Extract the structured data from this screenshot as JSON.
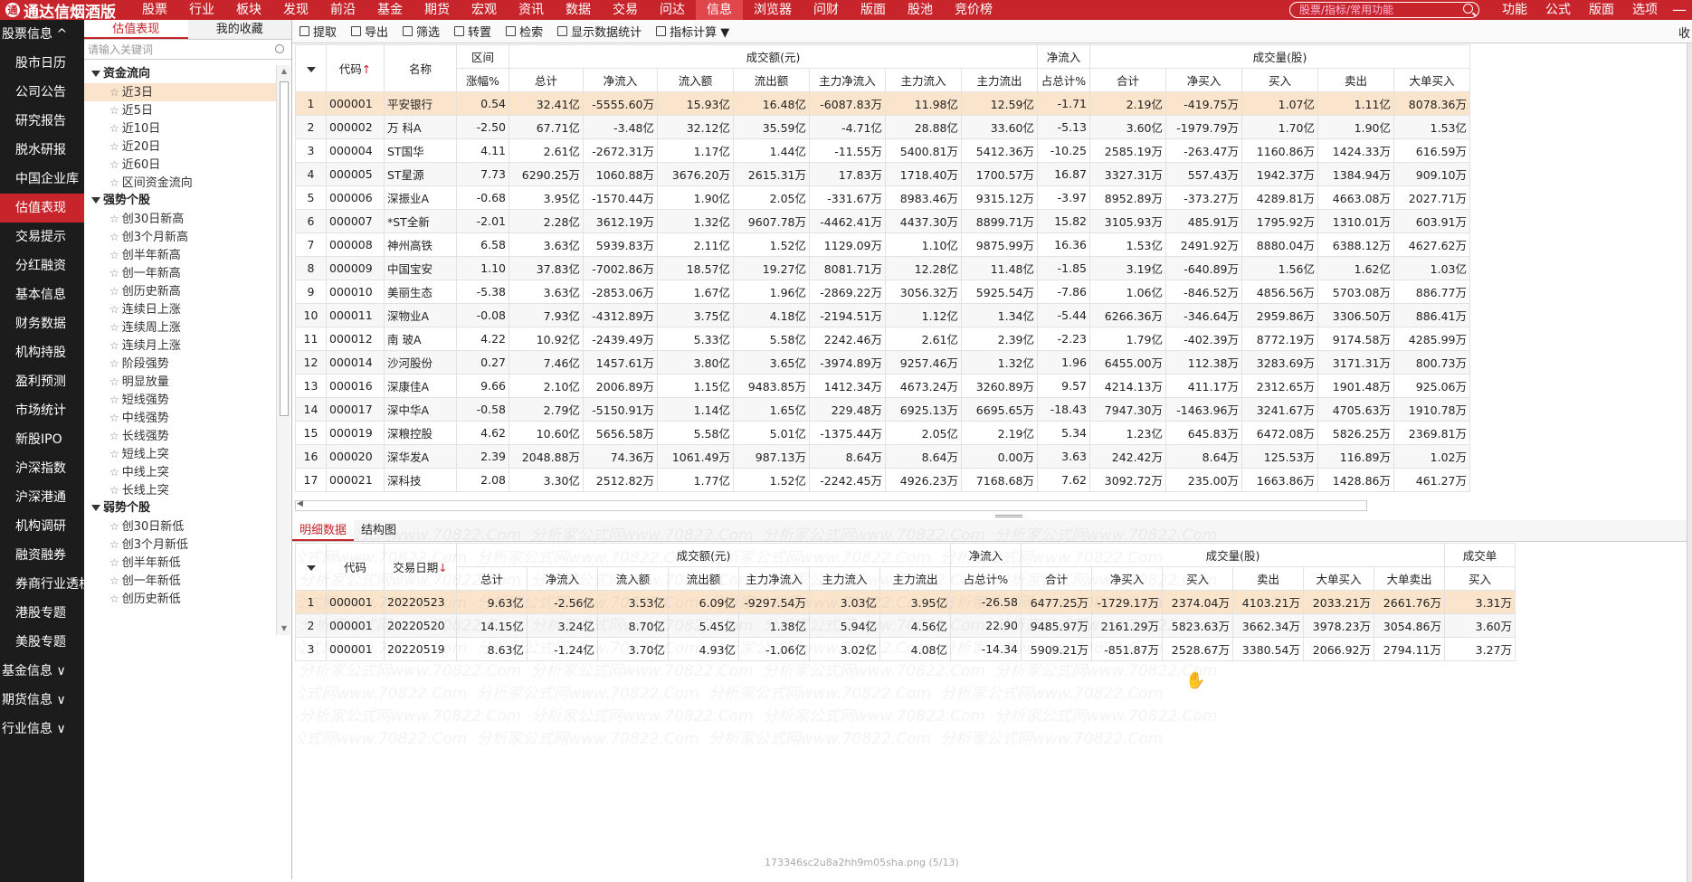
{
  "app": {
    "title": "通达信烟酒版",
    "logo_mark": "通"
  },
  "menu": [
    "股票",
    "行业",
    "板块",
    "发现",
    "前沿",
    "基金",
    "期货",
    "宏观",
    "资讯",
    "数据",
    "交易",
    "问达",
    "信息",
    "浏览器",
    "问财",
    "版面",
    "股池",
    "竞价榜"
  ],
  "search": {
    "placeholder": "股票/指标/常用功能"
  },
  "right_menu": [
    "功能",
    "公式",
    "版面",
    "选项"
  ],
  "window": {
    "minimize": "—"
  },
  "leftnav": [
    "股票信息 ^",
    "股市日历",
    "公司公告",
    "研究报告",
    "脱水研报",
    "中国企业库",
    "估值表现",
    "交易提示",
    "分红融资",
    "基本信息",
    "财务数据",
    "机构持股",
    "盈利预测",
    "市场统计",
    "新股IPO",
    "沪深指数",
    "沪深港通",
    "机构调研",
    "融资融券",
    "券商行业透析",
    "港股专题",
    "美股专题",
    "基金信息 ∨",
    "期货信息 ∨",
    "行业信息 ∨"
  ],
  "tree": {
    "tabs": [
      "估值表现",
      "我的收藏"
    ],
    "search_placeholder": "请输入关键词",
    "groups": [
      {
        "name": "资金流向",
        "items": [
          "近3日",
          "近5日",
          "近10日",
          "近20日",
          "近60日",
          "区间资金流向"
        ]
      },
      {
        "name": "强势个股",
        "items": [
          "创30日新高",
          "创3个月新高",
          "创半年新高",
          "创一年新高",
          "创历史新高",
          "连续日上涨",
          "连续周上涨",
          "连续月上涨",
          "阶段强势",
          "明显放量",
          "短线强势",
          "中线强势",
          "长线强势",
          "短线上突",
          "中线上突",
          "长线上突"
        ]
      },
      {
        "name": "弱势个股",
        "items": [
          "创30日新低",
          "创3个月新低",
          "创半年新低",
          "创一年新低",
          "创历史新低"
        ]
      }
    ]
  },
  "toolbar": {
    "buttons": [
      "提取",
      "导出",
      "筛选",
      "转置",
      "检索",
      "显示数据统计",
      "指标计算 ▼"
    ],
    "right": "收"
  },
  "top_table": {
    "group_headers": {
      "interval": "区间",
      "amount": "成交额(元)",
      "netflow": "净流入",
      "volume": "成交量(股)"
    },
    "columns": [
      "代码",
      "名称",
      "涨幅%",
      "总计",
      "净流入",
      "流入额",
      "流出额",
      "主力净流入",
      "主力流入",
      "主力流出",
      "占总计%",
      "合计",
      "净买入",
      "买入",
      "卖出",
      "大单买入"
    ],
    "code_sort": "↑",
    "rows": [
      [
        "1",
        "000001",
        "平安银行",
        "0.54",
        "32.41亿",
        "-5555.60万",
        "15.93亿",
        "16.48亿",
        "-6087.83万",
        "11.98亿",
        "12.59亿",
        "-1.71",
        "2.19亿",
        "-419.75万",
        "1.07亿",
        "1.11亿",
        "8078.36万"
      ],
      [
        "2",
        "000002",
        "万 科A",
        "-2.50",
        "67.71亿",
        "-3.48亿",
        "32.12亿",
        "35.59亿",
        "-4.71亿",
        "28.88亿",
        "33.60亿",
        "-5.13",
        "3.60亿",
        "-1979.79万",
        "1.70亿",
        "1.90亿",
        "1.53亿"
      ],
      [
        "3",
        "000004",
        "ST国华",
        "4.11",
        "2.61亿",
        "-2672.31万",
        "1.17亿",
        "1.44亿",
        "-11.55万",
        "5400.81万",
        "5412.36万",
        "-10.25",
        "2585.19万",
        "-263.47万",
        "1160.86万",
        "1424.33万",
        "616.59万"
      ],
      [
        "4",
        "000005",
        "ST星源",
        "7.73",
        "6290.25万",
        "1060.88万",
        "3676.20万",
        "2615.31万",
        "17.83万",
        "1718.40万",
        "1700.57万",
        "16.87",
        "3327.31万",
        "557.43万",
        "1942.37万",
        "1384.94万",
        "909.10万"
      ],
      [
        "5",
        "000006",
        "深振业A",
        "-0.68",
        "3.95亿",
        "-1570.44万",
        "1.90亿",
        "2.05亿",
        "-331.67万",
        "8983.46万",
        "9315.12万",
        "-3.97",
        "8952.89万",
        "-373.27万",
        "4289.81万",
        "4663.08万",
        "2027.71万"
      ],
      [
        "6",
        "000007",
        "*ST全新",
        "-2.01",
        "2.28亿",
        "3612.19万",
        "1.32亿",
        "9607.78万",
        "-4462.41万",
        "4437.30万",
        "8899.71万",
        "15.82",
        "3105.93万",
        "485.91万",
        "1795.92万",
        "1310.01万",
        "603.91万"
      ],
      [
        "7",
        "000008",
        "神州高铁",
        "6.58",
        "3.63亿",
        "5939.83万",
        "2.11亿",
        "1.52亿",
        "1129.09万",
        "1.10亿",
        "9875.99万",
        "16.36",
        "1.53亿",
        "2491.92万",
        "8880.04万",
        "6388.12万",
        "4627.62万"
      ],
      [
        "8",
        "000009",
        "中国宝安",
        "1.10",
        "37.83亿",
        "-7002.86万",
        "18.57亿",
        "19.27亿",
        "8081.71万",
        "12.28亿",
        "11.48亿",
        "-1.85",
        "3.19亿",
        "-640.89万",
        "1.56亿",
        "1.62亿",
        "1.03亿"
      ],
      [
        "9",
        "000010",
        "美丽生态",
        "-5.38",
        "3.63亿",
        "-2853.06万",
        "1.67亿",
        "1.96亿",
        "-2869.22万",
        "3056.32万",
        "5925.54万",
        "-7.86",
        "1.06亿",
        "-846.52万",
        "4856.56万",
        "5703.08万",
        "886.77万"
      ],
      [
        "10",
        "000011",
        "深物业A",
        "-0.08",
        "7.93亿",
        "-4312.89万",
        "3.75亿",
        "4.18亿",
        "-2194.51万",
        "1.12亿",
        "1.34亿",
        "-5.44",
        "6266.36万",
        "-346.64万",
        "2959.86万",
        "3306.50万",
        "886.41万"
      ],
      [
        "11",
        "000012",
        "南 玻A",
        "4.22",
        "10.92亿",
        "-2439.49万",
        "5.33亿",
        "5.58亿",
        "2242.46万",
        "2.61亿",
        "2.39亿",
        "-2.23",
        "1.79亿",
        "-402.39万",
        "8772.19万",
        "9174.58万",
        "4285.99万"
      ],
      [
        "12",
        "000014",
        "沙河股份",
        "0.27",
        "7.46亿",
        "1457.61万",
        "3.80亿",
        "3.65亿",
        "-3974.89万",
        "9257.46万",
        "1.32亿",
        "1.96",
        "6455.00万",
        "112.38万",
        "3283.69万",
        "3171.31万",
        "800.73万"
      ],
      [
        "13",
        "000016",
        "深康佳A",
        "9.66",
        "2.10亿",
        "2006.89万",
        "1.15亿",
        "9483.85万",
        "1412.34万",
        "4673.24万",
        "3260.89万",
        "9.57",
        "4214.13万",
        "411.17万",
        "2312.65万",
        "1901.48万",
        "925.06万"
      ],
      [
        "14",
        "000017",
        "深中华A",
        "-0.58",
        "2.79亿",
        "-5150.91万",
        "1.14亿",
        "1.65亿",
        "229.48万",
        "6925.13万",
        "6695.65万",
        "-18.43",
        "7947.30万",
        "-1463.96万",
        "3241.67万",
        "4705.63万",
        "1910.78万"
      ],
      [
        "15",
        "000019",
        "深粮控股",
        "4.62",
        "10.60亿",
        "5656.58万",
        "5.58亿",
        "5.01亿",
        "-1375.44万",
        "2.05亿",
        "2.19亿",
        "5.34",
        "1.23亿",
        "645.83万",
        "6472.08万",
        "5826.25万",
        "2369.81万"
      ],
      [
        "16",
        "000020",
        "深华发A",
        "2.39",
        "2048.88万",
        "74.36万",
        "1061.49万",
        "987.13万",
        "8.64万",
        "8.64万",
        "0.00万",
        "3.63",
        "242.42万",
        "8.64万",
        "125.53万",
        "116.89万",
        "1.02万"
      ],
      [
        "17",
        "000021",
        "深科技",
        "2.08",
        "3.30亿",
        "2512.82万",
        "1.77亿",
        "1.52亿",
        "-2242.45万",
        "4926.23万",
        "7168.68万",
        "7.62",
        "3092.72万",
        "235.00万",
        "1663.86万",
        "1428.86万",
        "461.27万"
      ]
    ]
  },
  "bottom_tabs": [
    "明细数据",
    "结构图"
  ],
  "bottom_table": {
    "group_headers": {
      "amount": "成交额(元)",
      "netflow": "净流入",
      "volume": "成交量(股)",
      "amount2": "成交单"
    },
    "columns": [
      "代码",
      "交易日期",
      "总计",
      "净流入",
      "流入额",
      "流出额",
      "主力净流入",
      "主力流入",
      "主力流出",
      "占总计%",
      "合计",
      "净买入",
      "买入",
      "卖出",
      "大单买入",
      "大单卖出",
      "买入"
    ],
    "date_sort": "↓",
    "rows": [
      [
        "1",
        "000001",
        "20220523",
        "9.63亿",
        "-2.56亿",
        "3.53亿",
        "6.09亿",
        "-9297.54万",
        "3.03亿",
        "3.95亿",
        "-26.58",
        "6477.25万",
        "-1729.17万",
        "2374.04万",
        "4103.21万",
        "2033.21万",
        "2661.76万",
        "3.31万"
      ],
      [
        "2",
        "000001",
        "20220520",
        "14.15亿",
        "3.24亿",
        "8.70亿",
        "5.45亿",
        "1.38亿",
        "5.94亿",
        "4.56亿",
        "22.90",
        "9485.97万",
        "2161.29万",
        "5823.63万",
        "3662.34万",
        "3978.23万",
        "3054.86万",
        "3.60万"
      ],
      [
        "3",
        "000001",
        "20220519",
        "8.63亿",
        "-1.24亿",
        "3.70亿",
        "4.93亿",
        "-1.06亿",
        "3.02亿",
        "4.08亿",
        "-14.34",
        "5909.21万",
        "-851.87万",
        "2528.67万",
        "3380.54万",
        "2066.92万",
        "2794.11万",
        "3.27万"
      ]
    ]
  },
  "watermark": "分析家公式网www.70822.Com",
  "footer_caption": "173346sc2u8a2hh9m05sha.png (5/13)",
  "cursor": "✋"
}
